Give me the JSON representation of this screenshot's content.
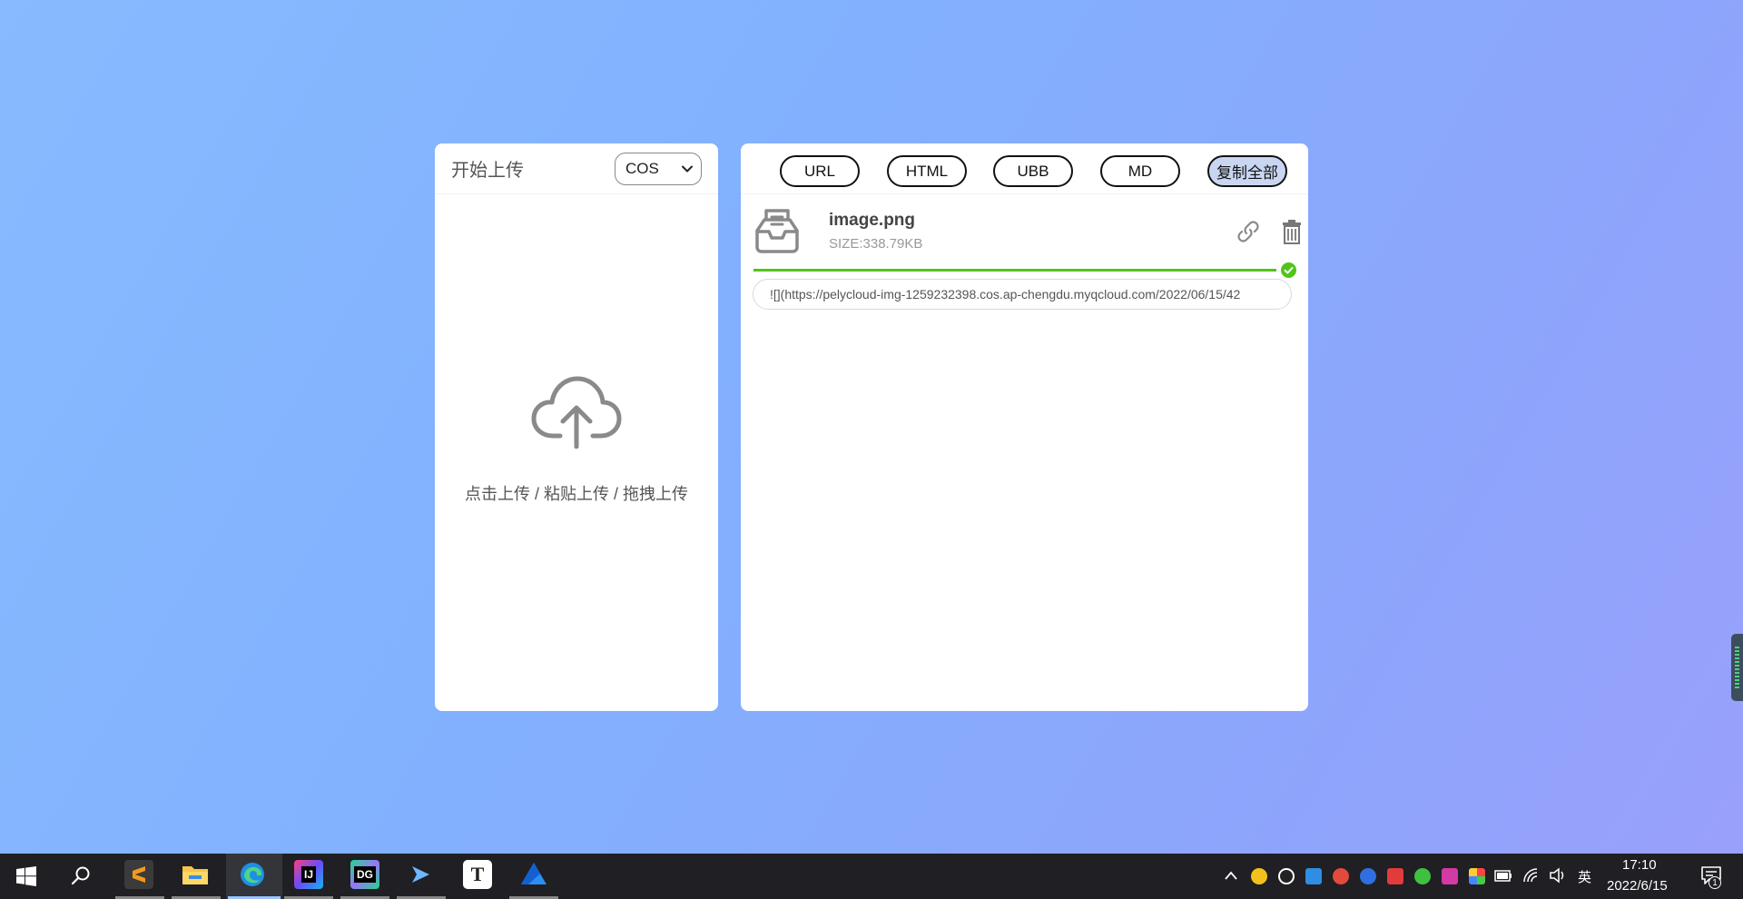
{
  "upload_panel": {
    "title": "开始上传",
    "storage_select": {
      "value": "COS"
    },
    "drop_hint": "点击上传 / 粘贴上传 / 拖拽上传"
  },
  "result_panel": {
    "format_buttons": [
      "URL",
      "HTML",
      "UBB",
      "MD"
    ],
    "copy_all_label": "复制全部",
    "file": {
      "name": "image.png",
      "size": "SIZE:338.79KB",
      "progress_percent": 100,
      "link_value": "![](https://pelycloud-img-1259232398.cos.ap-chengdu.myqcloud.com/2022/06/15/42"
    }
  },
  "taskbar": {
    "apps": [
      "sublime-text",
      "file-explorer",
      "edge",
      "intellij-idea",
      "datagrip",
      "terminal",
      "typora",
      "app"
    ],
    "tray": {
      "ime": "英",
      "time": "17:10",
      "date": "2022/6/15",
      "notification_count": "1"
    }
  },
  "colors": {
    "accent_green": "#52c41a",
    "copy_all_bg": "#c9d6f2"
  }
}
